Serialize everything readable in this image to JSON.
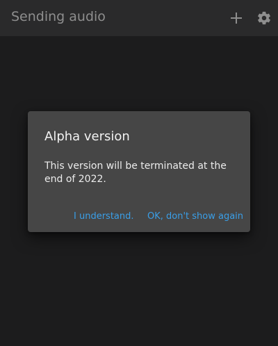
{
  "appbar": {
    "title": "Sending audio",
    "add_icon": "plus-icon",
    "settings_icon": "gear-icon"
  },
  "dialog": {
    "title": "Alpha version",
    "message": "This version will be terminated at the end of 2022.",
    "actions": {
      "understand": "I understand.",
      "dont_show_again": "OK, don't show again"
    }
  },
  "colors": {
    "background": "#1c1c1d",
    "appbar": "#2a2a2b",
    "dialog": "#464646",
    "accent": "#3a9fe8",
    "title_text": "#8e8e8e"
  }
}
